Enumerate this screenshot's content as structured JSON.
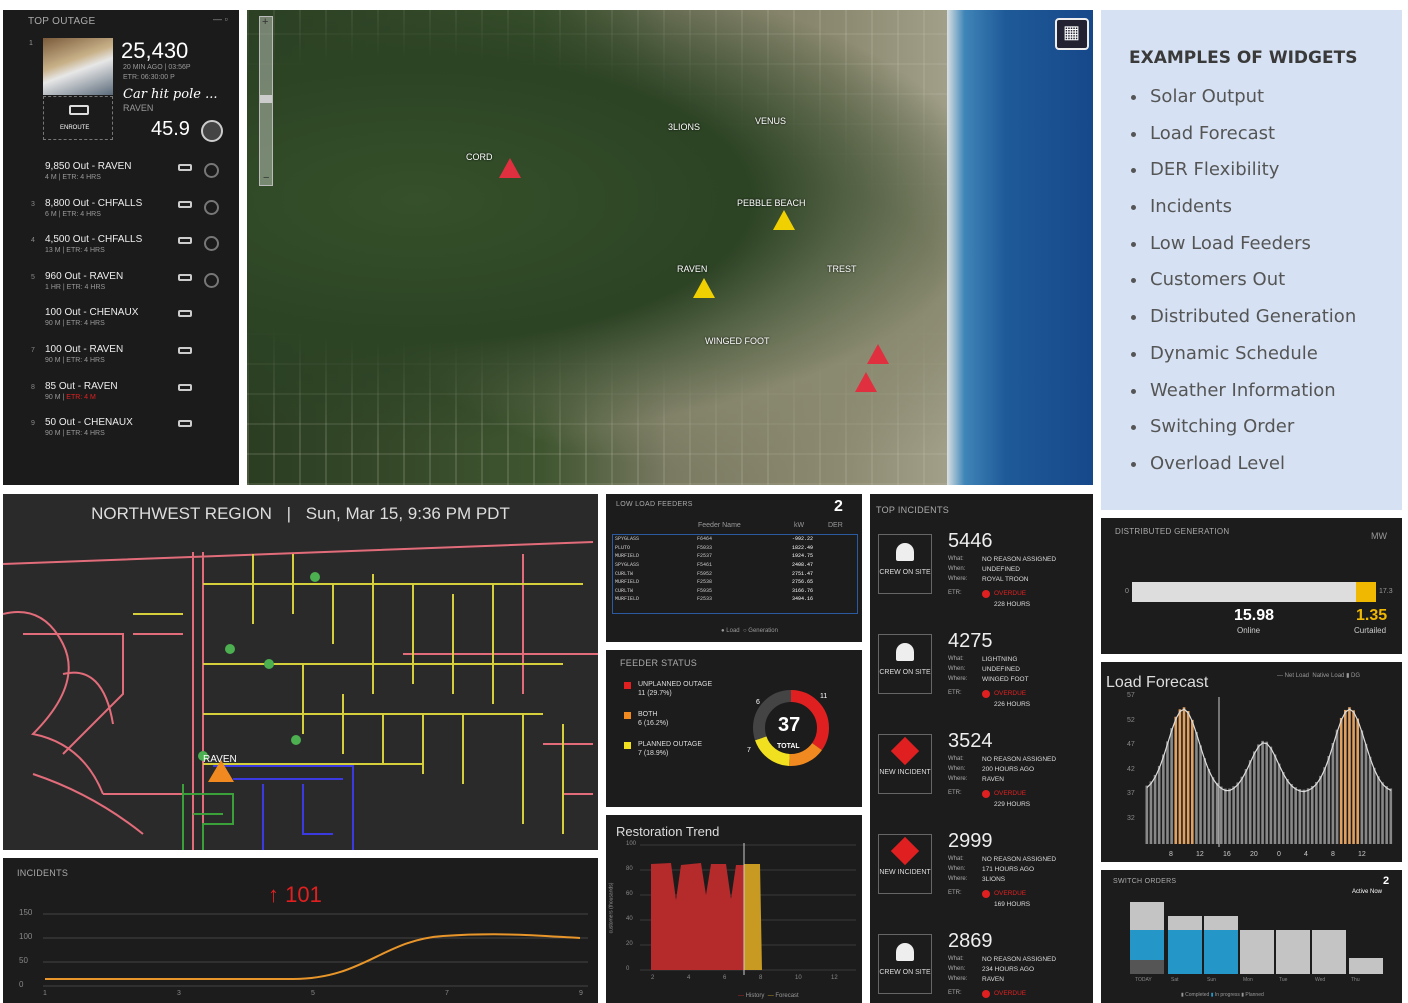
{
  "top_outage": {
    "title": "TOP OUTAGE",
    "count": "25,430",
    "ago": "20 MIN AGO | 03:56P",
    "etr": "ETR: 06:30:00 P",
    "cause": "Car hit pole ...",
    "feeder": "RAVEN",
    "status": "ENROUTE",
    "score": "45.9",
    "rank": "1",
    "items": [
      {
        "rank": "",
        "label": "9,850 Out - RAVEN",
        "sub": "4 M | ETR: 4 HRS"
      },
      {
        "rank": "3",
        "label": "8,800 Out - CHFALLS",
        "sub": "6 M | ETR: 4 HRS"
      },
      {
        "rank": "4",
        "label": "4,500 Out - CHFALLS",
        "sub": "13 M | ETR: 4 HRS"
      },
      {
        "rank": "5",
        "label": "960 Out - RAVEN",
        "sub": "1 HR | ETR: 4 HRS"
      },
      {
        "rank": "",
        "label": "100 Out - CHENAUX",
        "sub": "90 M | ETR: 4 HRS"
      },
      {
        "rank": "7",
        "label": "100 Out - RAVEN",
        "sub": "90 M | ETR: 4 HRS"
      },
      {
        "rank": "8",
        "label": "85 Out - RAVEN",
        "sub": "90 M | ",
        "sub_red": "ETR: 4 M"
      },
      {
        "rank": "9",
        "label": "50 Out - CHENAUX",
        "sub": "90 M | ETR: 4 HRS"
      }
    ]
  },
  "map": {
    "places": [
      "CORD",
      "3LIONS",
      "VENUS",
      "PEBBLE BEACH",
      "RAVEN",
      "TREST",
      "WINGED FOOT"
    ],
    "zoom_in": "+",
    "zoom_out": "−"
  },
  "examples": {
    "title": "EXAMPLES OF WIDGETS",
    "items": [
      "Solar Output",
      "Load Forecast",
      "DER Flexibility",
      "Incidents",
      "Low Load Feeders",
      "Customers Out",
      "Distributed Generation",
      "Dynamic Schedule",
      "Weather Information",
      "Switching Order",
      "Overload Level"
    ]
  },
  "region": {
    "title": "NORTHWEST REGION",
    "sep": "|",
    "datetime": "Sun, Mar 15, 9:36 PM PDT",
    "marker": "RAVEN"
  },
  "incidents_chart": {
    "title": "INCIDENTS",
    "value": "↑ 101",
    "yticks": [
      "150",
      "100",
      "50",
      "0"
    ],
    "xticks": [
      "1",
      "3",
      "5",
      "7",
      "9"
    ]
  },
  "low_load": {
    "title": "LOW LOAD FEEDERS",
    "count": "2",
    "headers": [
      "Feeder Name",
      "kW",
      "DER"
    ],
    "rows": [
      [
        "SPYGLASS",
        "F6464",
        "-992.22"
      ],
      [
        "PLUTO",
        "F5033",
        "1822.49"
      ],
      [
        "MURFIELD",
        "F2537",
        "1924.75"
      ],
      [
        "SPYGLASS",
        "F5461",
        "2408.47"
      ],
      [
        "CURLTW",
        "F5952",
        "2751.47"
      ],
      [
        "MURFIELD",
        "F2538",
        "2756.65"
      ],
      [
        "CURLTW",
        "F5935",
        "3166.76"
      ],
      [
        "MURFIELD",
        "F2533",
        "3494.16"
      ]
    ],
    "legend": [
      "Load",
      "Generation"
    ]
  },
  "feeder_status": {
    "title": "FEEDER STATUS",
    "total": "37",
    "total_label": "TOTAL",
    "items": [
      {
        "label": "UNPLANNED OUTAGE",
        "value": "11 (29.7%)",
        "color": "#e02020"
      },
      {
        "label": "BOTH",
        "value": "6 (16.2%)",
        "color": "#f08a20"
      },
      {
        "label": "PLANNED OUTAGE",
        "value": "7 (18.9%)",
        "color": "#f0e020"
      }
    ],
    "ring_labels": [
      "11",
      "6",
      "7"
    ]
  },
  "restoration": {
    "title": "Restoration Trend",
    "yticks": [
      "100",
      "80",
      "60",
      "40",
      "20",
      "0"
    ],
    "xticks": [
      "2",
      "4",
      "6",
      "8",
      "10",
      "12"
    ],
    "ylabel": "customers (thousands)",
    "legend": [
      "History",
      "Forecast"
    ]
  },
  "top_incidents": {
    "title": "TOP INCIDENTS",
    "items": [
      {
        "id": "5446",
        "status": "CREW ON SITE",
        "what": "NO REASON ASSIGNED",
        "when": "UNDEFINED",
        "where": "ROYAL TROON",
        "etr": "OVERDUE",
        "hours": "228 HOURS",
        "type": "crew"
      },
      {
        "id": "4275",
        "status": "CREW ON SITE",
        "what": "LIGHTNING",
        "when": "UNDEFINED",
        "where": "WINGED FOOT",
        "etr": "OVERDUE",
        "hours": "226 HOURS",
        "type": "crew"
      },
      {
        "id": "3524",
        "status": "NEW INCIDENT",
        "what": "NO REASON ASSIGNED",
        "when": "200 HOURS AGO",
        "where": "RAVEN",
        "etr": "OVERDUE",
        "hours": "229 HOURS",
        "type": "new"
      },
      {
        "id": "2999",
        "status": "NEW INCIDENT",
        "what": "NO REASON ASSIGNED",
        "when": "171 HOURS AGO",
        "where": "3LIONS",
        "etr": "OVERDUE",
        "hours": "169 HOURS",
        "type": "new"
      },
      {
        "id": "2869",
        "status": "CREW ON SITE",
        "what": "NO REASON ASSIGNED",
        "when": "234 HOURS AGO",
        "where": "RAVEN",
        "etr": "OVERDUE",
        "hours": "",
        "type": "crew"
      }
    ],
    "labels": {
      "what": "What:",
      "when": "When:",
      "where": "Where:",
      "etr": "ETR:"
    }
  },
  "dist_gen": {
    "title": "DISTRIBUTED GENERATION",
    "unit": "MW",
    "min": "0",
    "max": "17.3",
    "online": "15.98",
    "online_label": "Online",
    "curtailed": "1.35",
    "curtailed_label": "Curtailed",
    "online_frac": 0.92
  },
  "load_forecast": {
    "title": "Load Forecast",
    "legend": [
      "Net Load",
      "Native Load",
      "DG"
    ],
    "yticks": [
      "57",
      "52",
      "47",
      "42",
      "37",
      "32"
    ],
    "xticks": [
      "8",
      "12",
      "16",
      "20",
      "0",
      "4",
      "8",
      "12"
    ]
  },
  "switch_orders": {
    "title": "SWITCH ORDERS",
    "count": "2",
    "count_label": "Active Now",
    "xticks": [
      "TODAY",
      "Sat",
      "Sun",
      "Mon",
      "Tue",
      "Wed",
      "Thu"
    ],
    "legend": [
      "Completed",
      "In progress",
      "Planned"
    ]
  }
}
